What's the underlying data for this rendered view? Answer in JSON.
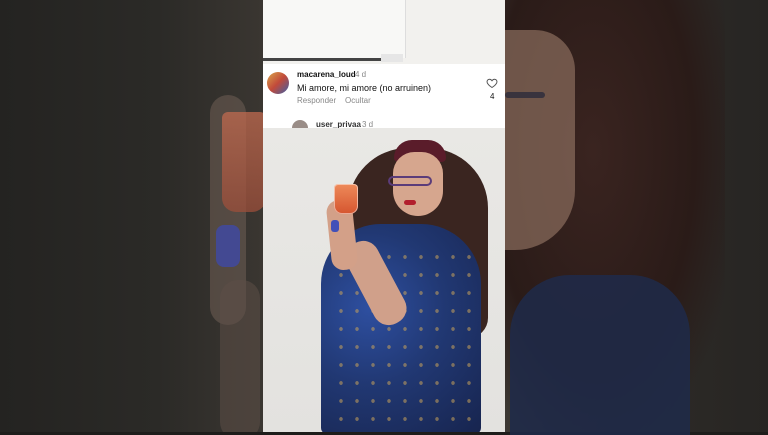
{
  "comment": {
    "username": "macarena_loud",
    "time": "4 d",
    "text": "Mi amore, mi amore (no arruinen)",
    "reply_label": "Responder",
    "hide_label": "Ocultar",
    "like_count": "4",
    "like_icon": "heart-icon"
  },
  "next_comment": {
    "username": "user_privaa",
    "time": "3 d"
  },
  "colors": {
    "card_bg": "#ffffff",
    "muted_text": "#888888",
    "dress": "#213873"
  }
}
